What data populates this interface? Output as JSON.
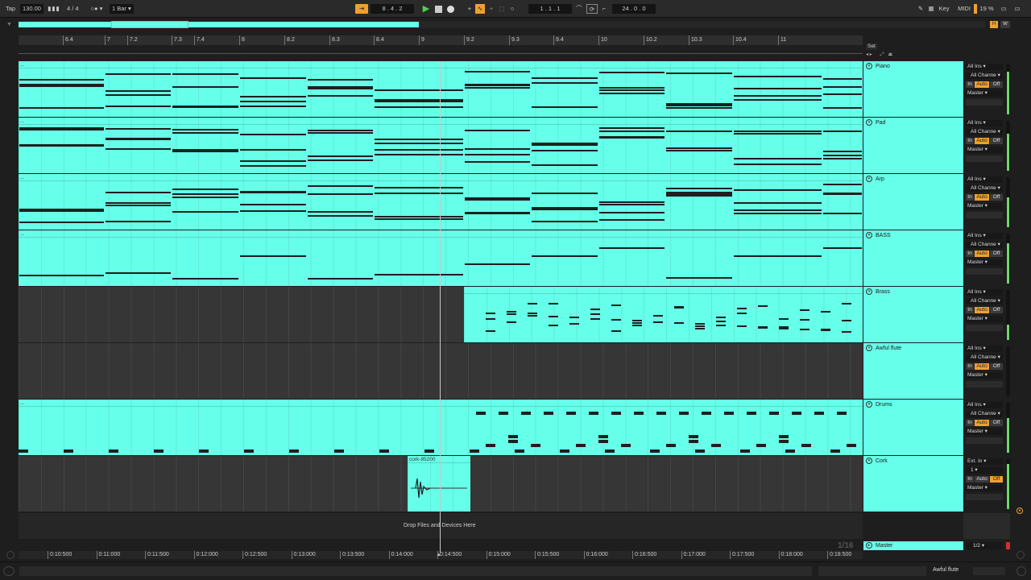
{
  "toolbar": {
    "tap": "Tap",
    "tempo": "130.00",
    "signature": "4 / 4",
    "quantize": "1 Bar",
    "position": "8 .  4 .  2",
    "loop_start": "1 .  1 .  1",
    "loop_length": "24 .  0 .  0",
    "key_label": "Key",
    "midi_label": "MIDI",
    "cpu": "19 %",
    "h": "H",
    "w": "W",
    "set_label": "Set"
  },
  "bar_ruler": [
    "6.4",
    "7",
    "7.2",
    "7.3",
    "7.4",
    "8",
    "8.2",
    "8.3",
    "8.4",
    "9",
    "9.2",
    "9.3",
    "9.4",
    "10",
    "10.2",
    "10.3",
    "10.4",
    "11"
  ],
  "time_ruler": [
    "0:10:500",
    "0:11:000",
    "0:11:500",
    "0:12:000",
    "0:12:500",
    "0:13:000",
    "0:13:500",
    "0:14:000",
    "0:14:500",
    "0:15:000",
    "0:15:500",
    "0:16:000",
    "0:16:500",
    "0:17:000",
    "0:17:500",
    "0:18:000",
    "0:18:500"
  ],
  "tracks": [
    {
      "name": "Piano",
      "input": "All Ins",
      "channel": "All Channe",
      "output": "Master",
      "level": 0.85,
      "clip_label": "..."
    },
    {
      "name": "Pad",
      "input": "All Ins",
      "channel": "All Channe",
      "output": "Master",
      "level": 0.75,
      "clip_label": "..."
    },
    {
      "name": "Arp",
      "input": "All Ins",
      "channel": "All Channe",
      "output": "Master",
      "level": 0.6,
      "clip_label": "..."
    },
    {
      "name": "BASS",
      "input": "All Ins",
      "channel": "All Channe",
      "output": "Master",
      "level": 0.8,
      "clip_label": "..."
    },
    {
      "name": "Brass",
      "input": "All Ins",
      "channel": "All Channe",
      "output": "Master",
      "level": 0.3,
      "clip_label": ""
    },
    {
      "name": "Awful flute",
      "input": "All Ins",
      "channel": "All Channe",
      "output": "Master",
      "level": 0.0,
      "clip_label": ""
    },
    {
      "name": "Drums",
      "input": "All Ins",
      "channel": "All Channe",
      "output": "Master",
      "level": 0.7,
      "clip_label": "..."
    },
    {
      "name": "Cork",
      "input": "Ext. In",
      "channel": "1",
      "output": "Master",
      "level": 0.9,
      "clip_label": "cork-85200"
    }
  ],
  "monitor": {
    "in": "In",
    "auto": "Auto",
    "off": "Off"
  },
  "drop_text": "Drop Files and Devices Here",
  "master": {
    "name": "Master",
    "output": "1/2",
    "counter": "1/16"
  },
  "status": {
    "track": "Awful flute"
  },
  "colors": {
    "clip": "#66ffe9",
    "accent": "#f0a030"
  }
}
